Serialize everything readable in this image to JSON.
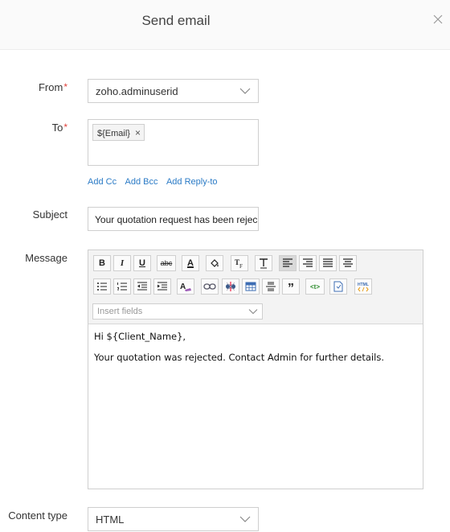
{
  "dialog": {
    "title": "Send email",
    "close_icon": "close-icon"
  },
  "form": {
    "from_label": "From",
    "from_required": "*",
    "from_value": "zoho.adminuserid",
    "to_label": "To",
    "to_required": "*",
    "to_chip": "${Email}",
    "chip_remove": "×",
    "add_cc": "Add Cc",
    "add_bcc": "Add Bcc",
    "add_reply_to": "Add Reply-to",
    "subject_label": "Subject",
    "subject_value": "Your quotation request has been rejec",
    "message_label": "Message",
    "content_type_label": "Content type",
    "content_type_value": "HTML"
  },
  "toolbar": {
    "row1": [
      "bold",
      "italic",
      "underline",
      "strikethrough",
      "font-color",
      "highlight",
      "font-size",
      "text-format",
      "align-left",
      "align-right",
      "justify",
      "align-center"
    ],
    "row2": [
      "bulleted-list",
      "numbered-list",
      "outdent",
      "indent",
      "clear-format",
      "link",
      "insert-image",
      "table",
      "horizontal-rule",
      "blockquote",
      "code",
      "insert-file",
      "html-source"
    ],
    "bold_label": "B",
    "italic_label": "I",
    "underline_label": "U",
    "strike_label": "abc",
    "font_color_label": "A",
    "quote_label": "”",
    "code_label": "<t>",
    "insert_fields_placeholder": "Insert fields"
  },
  "message": {
    "line1": "Hi  ${Client_Name},",
    "line2": "Your quotation was rejected. Contact Admin for further details."
  },
  "colors": {
    "link": "#2b7bc6",
    "required": "#e0403a",
    "border": "#cfcfcf"
  }
}
